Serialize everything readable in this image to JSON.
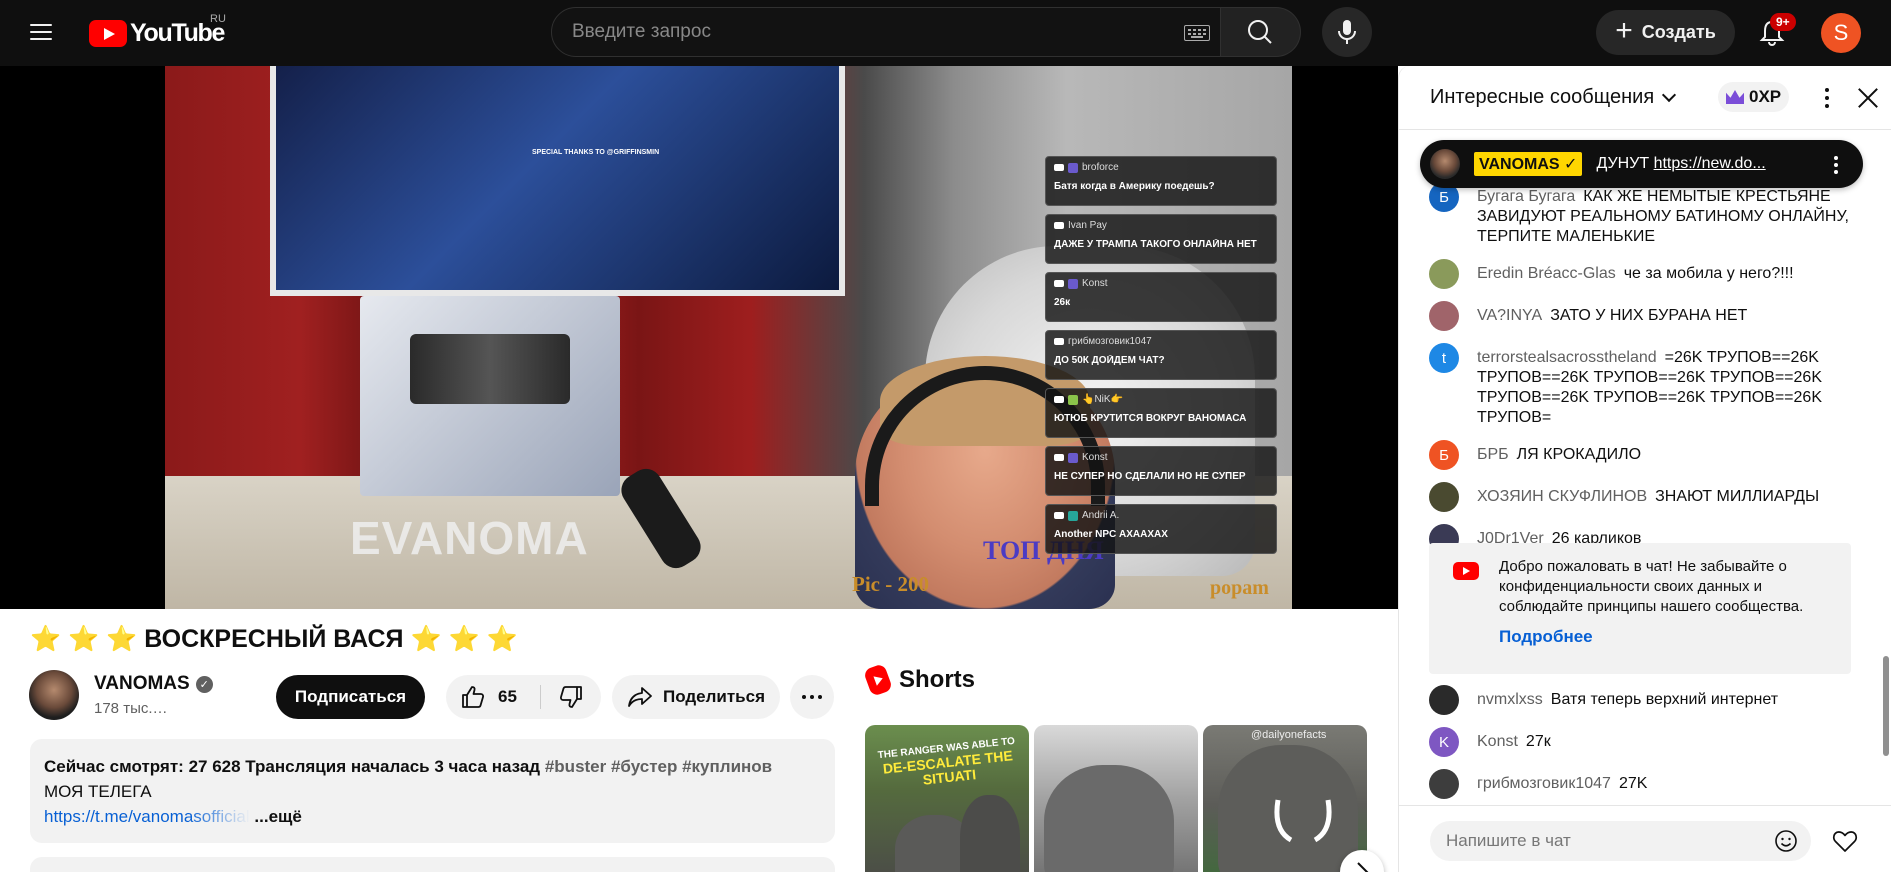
{
  "masthead": {
    "logo_text": "YouTube",
    "country_code": "RU",
    "search_placeholder": "Введите запрос",
    "create_label": "Создать",
    "notification_count": "9+",
    "avatar_letter": "S",
    "icons": [
      "menu-icon",
      "keyboard-icon",
      "search-icon",
      "mic-icon",
      "plus-icon",
      "bell-icon"
    ]
  },
  "player": {
    "overlay_tv_text": "SPECIAL THANKS TO @GRIFFINSMIN",
    "watermark_brand": "EVANOMA",
    "watermark_top": "ТОП ДНЯ",
    "watermark_pic": "Pic - 200",
    "watermark_popam": "popam",
    "overlay_chat": [
      {
        "name": "broforce",
        "text": "Батя когда в Америку поедешь?"
      },
      {
        "name": "Ivan Pay",
        "text": "ДАЖЕ У ТРАМПА ТАКОГО ОНЛАЙНА НЕТ"
      },
      {
        "name": "Konst",
        "text": "26к"
      },
      {
        "name": "грибмозговик1047",
        "text": "ДО 50К ДОЙДЕМ ЧАТ?"
      },
      {
        "name": "👆NiK👉",
        "text": "ЮТЮБ КРУТИТСЯ ВОКРУГ ВАНОМАСА"
      },
      {
        "name": "Konst",
        "text": "НЕ СУПЕР НО СДЕЛАЛИ НО НЕ СУПЕР"
      },
      {
        "name": "Andrii A.",
        "text": "Another NPC АХААХАХ"
      }
    ]
  },
  "video": {
    "title": "⭐ ⭐ ⭐ ВОСКРЕСНЫЙ ВАСЯ ⭐ ⭐ ⭐",
    "channel_name": "VANOMAS",
    "subscribers": "178 тыс.…",
    "subscribe_label": "Подписаться",
    "like_count": "65",
    "share_label": "Поделиться",
    "description": {
      "stats": "Сейчас смотрят: 27 628  Трансляция началась 3 часа назад",
      "tags": "#buster #бустер #куплинов",
      "line2": "МОЯ ТЕЛЕГА",
      "link": "https://t.me/vanomasofficial",
      "more": "...ещё"
    }
  },
  "shorts": {
    "heading": "Shorts",
    "items": [
      {
        "overlay_top": "THE RANGER WAS ABLE TO",
        "overlay_main": "DE-ESCALATE THE SITUATI"
      },
      {
        "overlay_top": "",
        "overlay_main": ""
      },
      {
        "overlay_top": "@dailyonefacts",
        "overlay_main": ""
      }
    ]
  },
  "chat": {
    "mode_label": "Интересные сообщения",
    "xp_label": "0XP",
    "pinned": {
      "author": "VANOMAS ✓",
      "text": "ДУНУТ ",
      "link": "https://new.do..."
    },
    "messages": [
      {
        "author": "Бугага Бугага",
        "text": "КАК ЖЕ НЕМЫТЫЕ КРЕСТЬЯНЕ ЗАВИДУЮТ РЕАЛЬНОМУ БАТИНОМУ ОНЛАЙНУ, ТЕРПИТЕ МАЛЕНЬКИЕ",
        "avatar_letter": "Б",
        "avatar_color": "#1565c0"
      },
      {
        "author": "Eredin Bréacc-Glas",
        "text": "че за мобила у него?!!!",
        "avatar_letter": "",
        "avatar_color": "#8a9a5b"
      },
      {
        "author": "VA?INYA",
        "text": "ЗАТО У НИХ БУРАНА НЕТ",
        "avatar_letter": "",
        "avatar_color": "#a0646a"
      },
      {
        "author": "terrorstealsacrosstheland",
        "text": "=26K ТРУПОВ==26K ТРУПОВ==26K ТРУПОВ==26K ТРУПОВ==26K ТРУПОВ==26K ТРУПОВ==26K ТРУПОВ==26K ТРУПОВ=",
        "avatar_letter": "t",
        "avatar_color": "#1e88e5"
      },
      {
        "author": "БРБ",
        "text": "ЛЯ КРОКАДИЛО",
        "avatar_letter": "Б",
        "avatar_color": "#ef5323"
      },
      {
        "author": "ХОЗЯИН СКУФЛИНОВ",
        "text": "ЗНАЮТ МИЛЛИАРДЫ",
        "avatar_letter": "",
        "avatar_color": "#4a4a30"
      },
      {
        "author": "J0Dr1Ver",
        "text": "26 карликов",
        "avatar_letter": "",
        "avatar_color": "#3a3a55"
      }
    ],
    "welcome": {
      "text": "Добро пожаловать в чат! Не забывайте о конфиденциальности своих данных и соблюдайте принципы нашего сообщества.",
      "link": "Подробнее"
    },
    "messages_after": [
      {
        "author": "nvmxlxss",
        "text": "Ватя теперь верхний интернет",
        "avatar_letter": "",
        "avatar_color": "#2a2a2a"
      },
      {
        "author": "Konst",
        "text": "27к",
        "avatar_letter": "K",
        "avatar_color": "#7e57c2"
      },
      {
        "author": "грибмозговик1047",
        "text": "27K",
        "avatar_letter": "",
        "avatar_color": "#3d3d3d"
      }
    ],
    "input_placeholder": "Напишите в чат"
  }
}
